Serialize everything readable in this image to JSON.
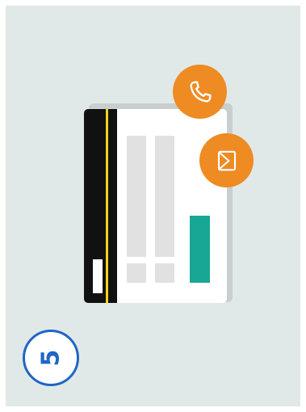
{
  "colors": {
    "background_panel": "#e1e8e8",
    "card": "#ffffff",
    "magnetic_stripe": "#111111",
    "stripe_line": "#f2d21b",
    "accent_teal": "#18a795",
    "icon_circle": "#ee8b22",
    "badge_blue": "#1f66c6"
  },
  "icons": {
    "phone": "phone-icon",
    "mail": "envelope-icon"
  },
  "step": {
    "number": "5"
  }
}
